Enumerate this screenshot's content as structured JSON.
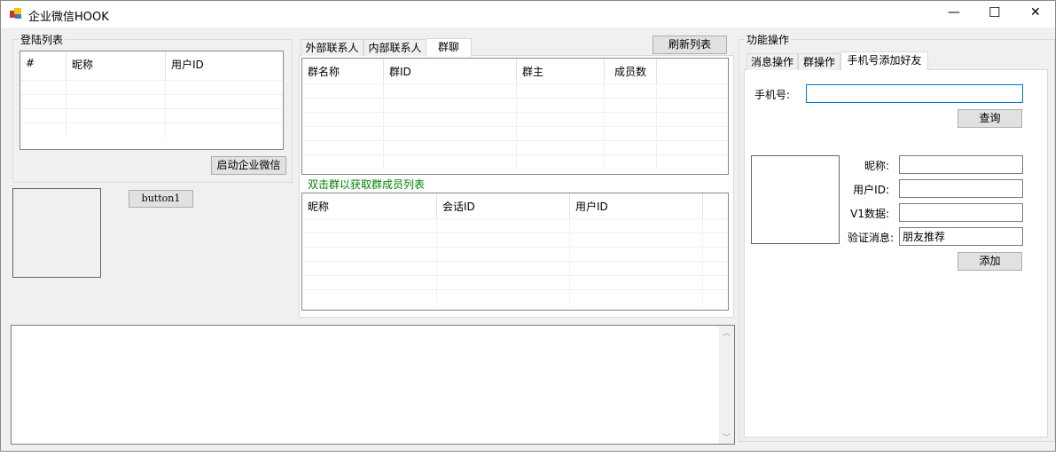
{
  "window": {
    "title": "企业微信HOOK",
    "controls": {
      "minimize": "—",
      "maximize": "☐",
      "close": "✕"
    }
  },
  "login_group": {
    "label": "登陆列表",
    "columns": [
      "#",
      "昵称",
      "用户ID"
    ],
    "start_button": "启动企业微信"
  },
  "button1": "button1",
  "contacts": {
    "tabs": [
      "外部联系人",
      "内部联系人",
      "群聊"
    ],
    "selected_tab": 2,
    "refresh_button": "刷新列表",
    "group_columns": [
      "群名称",
      "群ID",
      "群主",
      "成员数"
    ],
    "hint": "双击群以获取群成员列表",
    "member_columns": [
      "昵称",
      "会话ID",
      "用户ID"
    ]
  },
  "ops": {
    "label": "功能操作",
    "tabs": [
      "消息操作",
      "群操作",
      "手机号添加好友"
    ],
    "selected_tab": 2,
    "phone_label": "手机号:",
    "phone_value": "",
    "query_button": "查询",
    "nickname_label": "昵称:",
    "userid_label": "用户ID:",
    "v1_label": "V1数据:",
    "verify_label": "验证消息:",
    "nickname_value": "",
    "userid_value": "",
    "v1_value": "",
    "verify_value": "朋友推荐",
    "add_button": "添加"
  },
  "colors": {
    "hint": "#008000",
    "focus": "#0078d7"
  }
}
